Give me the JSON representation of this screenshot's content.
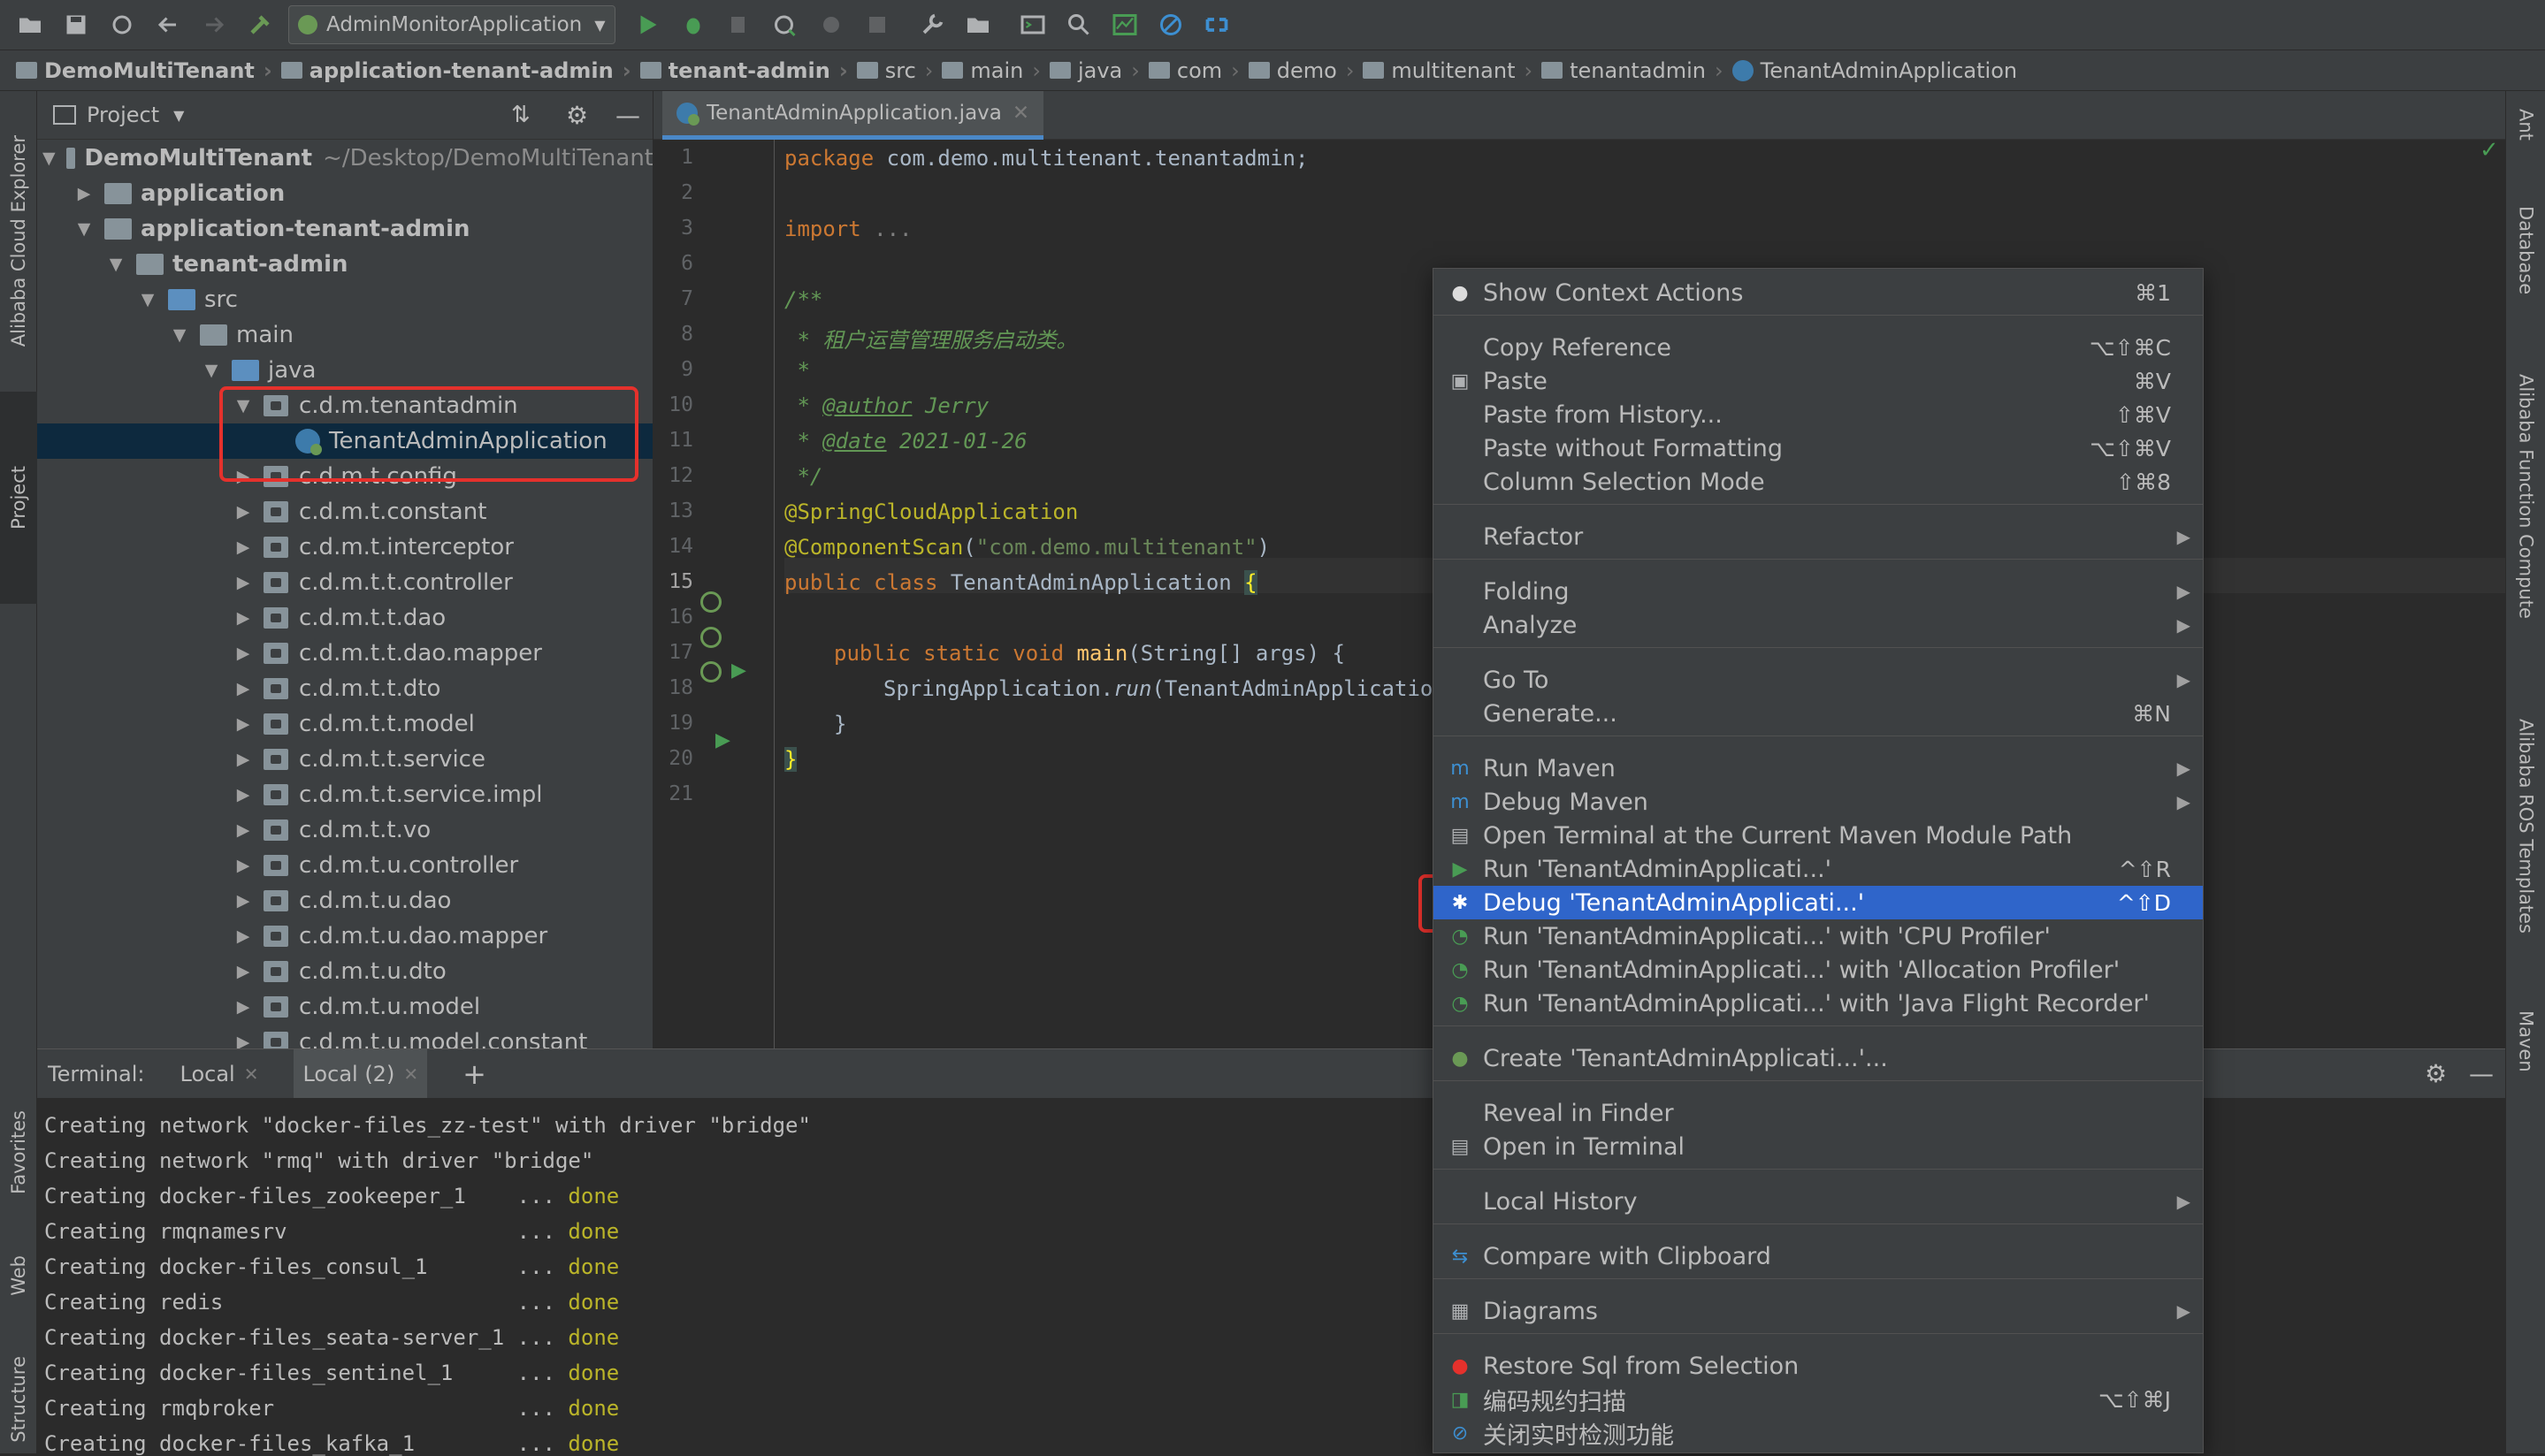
{
  "toolbar": {
    "run_config": "AdminMonitorApplication"
  },
  "breadcrumb": [
    {
      "label": "DemoMultiTenant",
      "bold": true
    },
    {
      "label": "application-tenant-admin",
      "bold": true
    },
    {
      "label": "tenant-admin",
      "bold": true
    },
    {
      "label": "src"
    },
    {
      "label": "main"
    },
    {
      "label": "java"
    },
    {
      "label": "com"
    },
    {
      "label": "demo"
    },
    {
      "label": "multitenant"
    },
    {
      "label": "tenantadmin"
    },
    {
      "label": "TenantAdminApplication"
    }
  ],
  "left_stripe": {
    "cloud_explorer": "Alibaba Cloud Explorer",
    "project": "Project",
    "favorites": "Favorites",
    "web": "Web",
    "structure": "Structure"
  },
  "right_stripe": {
    "ant": "Ant",
    "database": "Database",
    "function_compute": "Alibaba Function Compute",
    "ros": "Alibaba ROS Templates",
    "maven": "Maven"
  },
  "project_panel": {
    "title": "Project",
    "root_label": "DemoMultiTenant",
    "root_path": "~/Desktop/DemoMultiTenant",
    "items": [
      {
        "label": "application",
        "bold": true
      },
      {
        "label": "application-tenant-admin",
        "bold": true
      },
      {
        "label": "tenant-admin",
        "bold": true
      },
      {
        "label": "src"
      },
      {
        "label": "main"
      },
      {
        "label": "java"
      },
      {
        "label": "c.d.m.tenantadmin"
      },
      {
        "label": "TenantAdminApplication"
      },
      {
        "label": "c.d.m.t.config"
      },
      {
        "label": "c.d.m.t.constant"
      },
      {
        "label": "c.d.m.t.interceptor"
      },
      {
        "label": "c.d.m.t.t.controller"
      },
      {
        "label": "c.d.m.t.t.dao"
      },
      {
        "label": "c.d.m.t.t.dao.mapper"
      },
      {
        "label": "c.d.m.t.t.dto"
      },
      {
        "label": "c.d.m.t.t.model"
      },
      {
        "label": "c.d.m.t.t.service"
      },
      {
        "label": "c.d.m.t.t.service.impl"
      },
      {
        "label": "c.d.m.t.t.vo"
      },
      {
        "label": "c.d.m.t.u.controller"
      },
      {
        "label": "c.d.m.t.u.dao"
      },
      {
        "label": "c.d.m.t.u.dao.mapper"
      },
      {
        "label": "c.d.m.t.u.dto"
      },
      {
        "label": "c.d.m.t.u.model"
      },
      {
        "label": "c.d.m.t.u.model.constant"
      }
    ]
  },
  "editor": {
    "tab": "TenantAdminApplication.java",
    "line_numbers": [
      "1",
      "2",
      "3",
      "6",
      "7",
      "8",
      "9",
      "10",
      "11",
      "12",
      "13",
      "14",
      "15",
      "16",
      "17",
      "18",
      "19",
      "20",
      "21"
    ],
    "code": {
      "l1_kw": "package",
      "l1_rest": " com.demo.multitenant.tenantadmin;",
      "l3_kw": "import",
      "l3_rest": " ...",
      "l7": "/**",
      "l8": " * 租户运营管理服务启动类。",
      "l9": " *",
      "l10_pre": " * ",
      "l10_tag": "@author",
      "l10_val": " Jerry",
      "l11_pre": " * ",
      "l11_tag": "@date",
      "l11_val": " 2021-01-26",
      "l12": " */",
      "l13": "@SpringCloudApplication",
      "l14_an": "@ComponentScan",
      "l14_p1": "(",
      "l14_str": "\"com.demo.multitenant\"",
      "l14_p2": ")",
      "l15_kw": "public class",
      "l15_rest": " TenantAdminApplication ",
      "l15_brace": "{",
      "l17_kw": "public static void",
      "l17_fn": " main",
      "l17_rest": "(String[] args) {",
      "l18_a": "SpringApplication.",
      "l18_b": "run",
      "l18_c": "(TenantAdminApplication.",
      "l19": "}",
      "l20": "}"
    }
  },
  "terminal": {
    "label": "Terminal:",
    "tabs": [
      "Local",
      "Local (2)"
    ],
    "lines": [
      {
        "text": "Creating network \"docker-files_zz-test\" with driver \"bridge\"",
        "done": ""
      },
      {
        "text": "Creating network \"rmq\" with driver \"bridge\"",
        "done": ""
      },
      {
        "text": "Creating docker-files_zookeeper_1    ... ",
        "done": "done"
      },
      {
        "text": "Creating rmqnamesrv                  ... ",
        "done": "done"
      },
      {
        "text": "Creating docker-files_consul_1       ... ",
        "done": "done"
      },
      {
        "text": "Creating redis                       ... ",
        "done": "done"
      },
      {
        "text": "Creating docker-files_seata-server_1 ... ",
        "done": "done"
      },
      {
        "text": "Creating docker-files_sentinel_1     ... ",
        "done": "done"
      },
      {
        "text": "Creating rmqbroker                   ... ",
        "done": "done"
      },
      {
        "text": "Creating docker-files_kafka_1        ... ",
        "done": "done"
      }
    ]
  },
  "context_menu": {
    "items": [
      {
        "label": "Show Context Actions",
        "shortcut": "⌘1",
        "icon": "bulb-icon"
      },
      {
        "label": "Copy Reference",
        "shortcut": "⌥⇧⌘C"
      },
      {
        "label": "Paste",
        "shortcut": "⌘V",
        "icon": "clipboard-icon"
      },
      {
        "label": "Paste from History...",
        "shortcut": "⇧⌘V"
      },
      {
        "label": "Paste without Formatting",
        "shortcut": "⌥⇧⌘V"
      },
      {
        "label": "Column Selection Mode",
        "shortcut": "⇧⌘8"
      },
      {
        "label": "Refactor",
        "submenu": true
      },
      {
        "label": "Folding",
        "submenu": true
      },
      {
        "label": "Analyze",
        "submenu": true
      },
      {
        "label": "Go To",
        "submenu": true
      },
      {
        "label": "Generate...",
        "shortcut": "⌘N"
      },
      {
        "label": "Run Maven",
        "submenu": true,
        "icon": "maven-run-icon"
      },
      {
        "label": "Debug Maven",
        "submenu": true,
        "icon": "maven-debug-icon"
      },
      {
        "label": "Open Terminal at the Current Maven Module Path",
        "icon": "terminal-maven-icon"
      },
      {
        "label": "Run 'TenantAdminApplicati...'",
        "shortcut": "^⇧R",
        "icon": "run-icon"
      },
      {
        "label": "Debug 'TenantAdminApplicati...'",
        "shortcut": "^⇧D",
        "icon": "debug-icon",
        "highlight": true
      },
      {
        "label": "Run 'TenantAdminApplicati...' with 'CPU Profiler'",
        "icon": "profiler-icon"
      },
      {
        "label": "Run 'TenantAdminApplicati...' with 'Allocation Profiler'",
        "icon": "profiler-icon"
      },
      {
        "label": "Run 'TenantAdminApplicati...' with 'Java Flight Recorder'",
        "icon": "profiler-icon"
      },
      {
        "label": "Create 'TenantAdminApplicati...'...",
        "icon": "spring-config-icon"
      },
      {
        "label": "Reveal in Finder"
      },
      {
        "label": "Open in Terminal",
        "icon": "terminal-icon"
      },
      {
        "label": "Local History",
        "submenu": true
      },
      {
        "label": "Compare with Clipboard",
        "icon": "compare-icon"
      },
      {
        "label": "Diagrams",
        "submenu": true,
        "icon": "diagram-icon"
      },
      {
        "label": "Restore Sql from Selection",
        "icon": "sql-icon"
      },
      {
        "label": "编码规约扫描",
        "shortcut": "⌥⇧⌘J",
        "icon": "scan-icon"
      },
      {
        "label": "关闭实时检测功能",
        "icon": "disable-icon"
      }
    ]
  },
  "colors": {
    "highlight": "#2f65ca",
    "annotation_box": "#e5312c"
  }
}
